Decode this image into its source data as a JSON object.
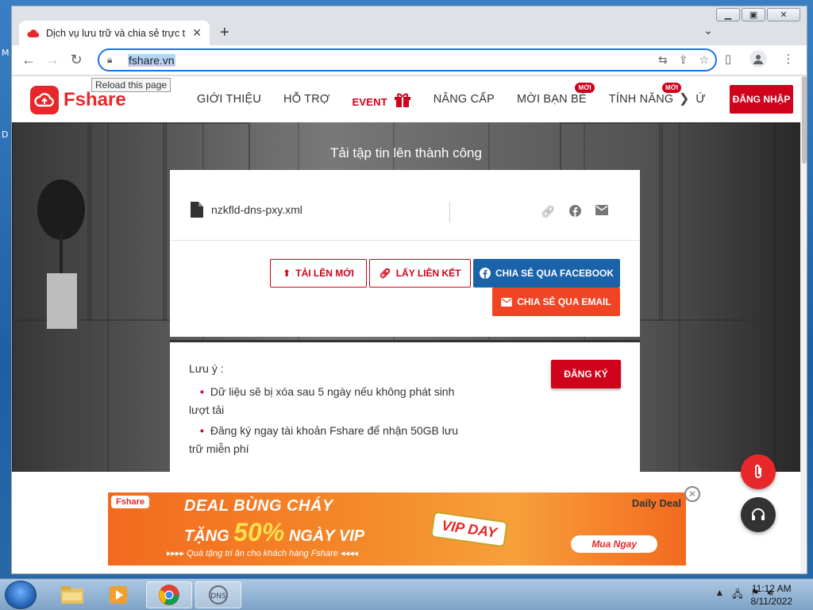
{
  "desktop": {
    "edge_text_1": "M",
    "edge_text_2": "D"
  },
  "browser": {
    "tab_title": "Dịch vụ lưu trữ và chia sẻ trực tuy",
    "url": "fshare.vn",
    "tooltip": "Reload this page"
  },
  "site": {
    "logo_text": "Fshare",
    "menu": [
      {
        "label": "GIỚI THIỆU",
        "badge": ""
      },
      {
        "label": "HỖ TRỢ",
        "badge": ""
      },
      {
        "label": "EVENT",
        "badge": ""
      },
      {
        "label": "NÂNG CẤP",
        "badge": ""
      },
      {
        "label": "MỜI BẠN BÈ",
        "badge": "MỚI"
      },
      {
        "label": "TÍNH NĂNG",
        "badge": "MỚI"
      },
      {
        "label": "Ứ",
        "badge": ""
      }
    ],
    "login_label": "ĐĂNG NHẬP"
  },
  "upload": {
    "heading": "Tải tập tin lên thành công",
    "filename": "nzkfld-dns-pxy.xml",
    "buttons": {
      "upload_new": "TẢI LÊN MỚI",
      "get_link": "LẤY LIÊN KẾT",
      "share_facebook": "CHIA SẺ QUA FACEBOOK",
      "share_email": "CHIA SẺ QUA EMAIL"
    }
  },
  "notes": {
    "title": "Lưu ý :",
    "items": [
      "Dữ liệu sẽ bị xóa sau 5 ngày nếu không phát sinh lượt tải",
      "Đăng ký ngay tài khoản Fshare để nhận 50GB lưu trữ miễn phí"
    ],
    "register_label": "ĐĂNG KÝ"
  },
  "banner": {
    "logo": "Fshare",
    "line1": "DEAL BÙNG CHÁY",
    "line2_prefix": "TẶNG",
    "line2_pct": "50%",
    "line2_suffix": "NGÀY VIP",
    "sub": "▸▸▸▸ Quà tặng tri ân cho khách hàng Fshare ◂◂◂◂",
    "vip": "VIP DAY",
    "daily": "Daily Deal",
    "cta": "Mua Ngay"
  },
  "taskbar": {
    "time": "11:12 AM",
    "date": "8/11/2022"
  },
  "colors": {
    "brand_red": "#d0021b",
    "facebook": "#1b63a8",
    "email": "#f04425",
    "chrome_focus": "#1a73e8"
  }
}
